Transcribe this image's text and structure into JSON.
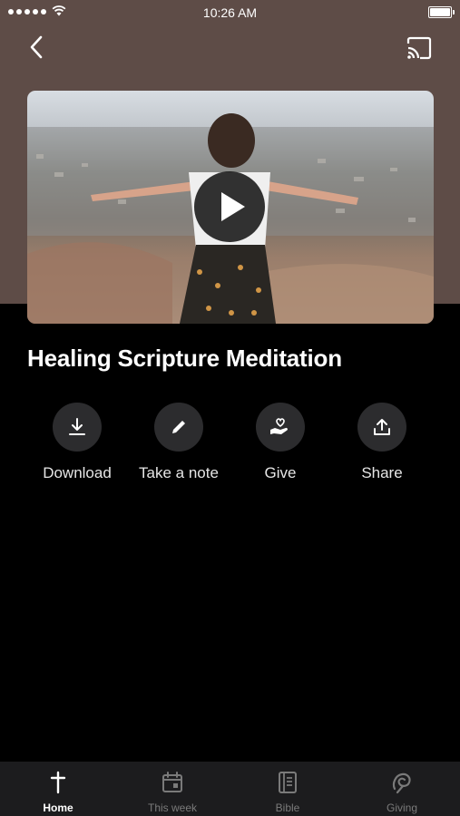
{
  "status_bar": {
    "time": "10:26 AM"
  },
  "nav": {
    "back_icon": "chevron-left-icon",
    "cast_icon": "cast-icon"
  },
  "media": {
    "title": "Healing Scripture Meditation",
    "play_icon": "play-icon"
  },
  "actions": [
    {
      "label": "Download",
      "icon": "download-icon"
    },
    {
      "label": "Take a note",
      "icon": "pencil-icon"
    },
    {
      "label": "Give",
      "icon": "heart-hand-icon"
    },
    {
      "label": "Share",
      "icon": "share-icon"
    }
  ],
  "tabs": [
    {
      "label": "Home",
      "icon": "cross-icon",
      "active": true
    },
    {
      "label": "This week",
      "icon": "calendar-icon",
      "active": false
    },
    {
      "label": "Bible",
      "icon": "bible-icon",
      "active": false
    },
    {
      "label": "Giving",
      "icon": "giving-icon",
      "active": false
    }
  ],
  "colors": {
    "header_background": "#5e4c47",
    "tab_bar": "#1c1c1e",
    "action_circle": "#2c2c2e",
    "inactive_tab": "#7a7a7a"
  }
}
